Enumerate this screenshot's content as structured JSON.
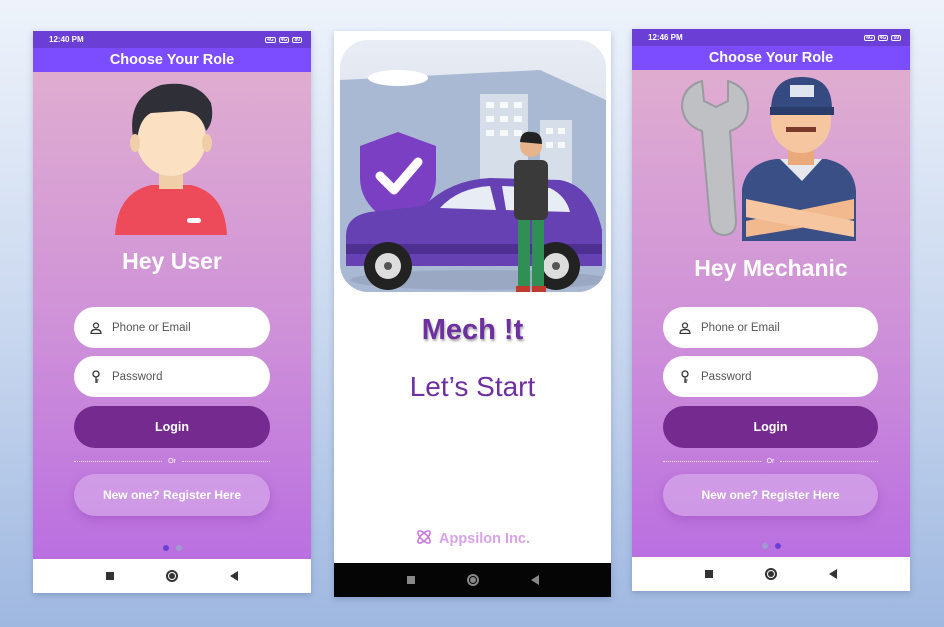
{
  "phone_left": {
    "status_time": "12:40 PM",
    "status_battery": "80",
    "appbar_title": "Choose Your Role",
    "greeting": "Hey User",
    "phone_placeholder": "Phone or Email",
    "password_placeholder": "Password",
    "login_label": "Login",
    "or_label": "Or",
    "register_label": "New one? Register Here",
    "page_indicator": {
      "count": 2,
      "active": 1
    }
  },
  "phone_middle": {
    "app_name": "Mech  !t",
    "tagline": "Let’s  Start",
    "brand": "Appsilon Inc."
  },
  "phone_right": {
    "status_time": "12:46 PM",
    "status_battery": "59",
    "appbar_title": "Choose Your Role",
    "greeting": "Hey Mechanic",
    "phone_placeholder": "Phone or Email",
    "password_placeholder": "Password",
    "login_label": "Login",
    "or_label": "Or",
    "register_label": "New one? Register Here",
    "page_indicator": {
      "count": 2,
      "active": 2
    }
  },
  "colors": {
    "statusbar": "#6b3fd6",
    "appbar": "#7c4dff",
    "login_button": "#742a8f",
    "brand_text": "#6e2fa0"
  },
  "icons": [
    "person-icon",
    "key-icon",
    "home-square-icon",
    "home-circle-icon",
    "back-triangle-icon",
    "appsilon-logo-icon"
  ]
}
